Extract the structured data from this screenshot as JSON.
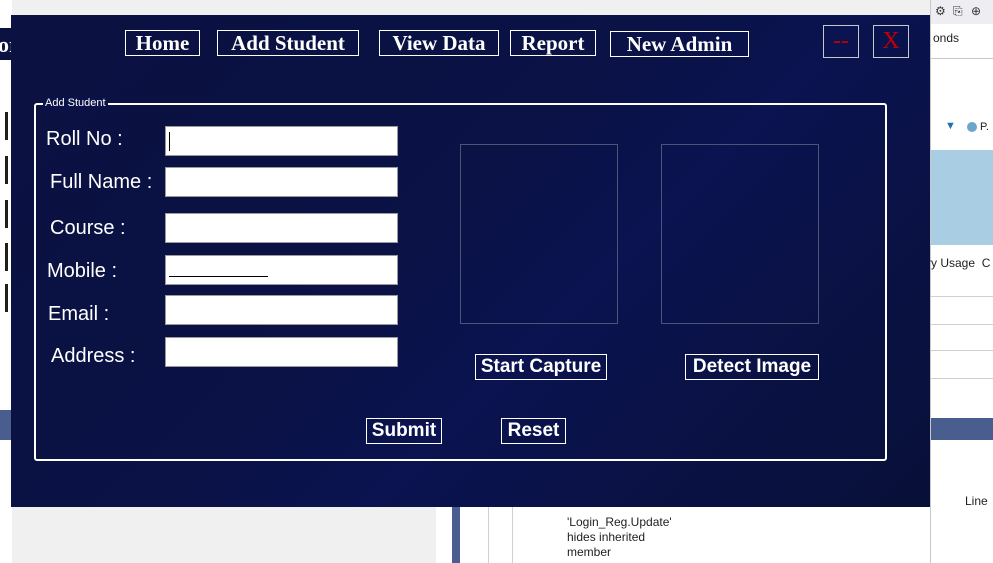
{
  "background": {
    "left_fragment_text": "or",
    "right_panel": {
      "seconds_text": "onds",
      "legend_marker": "▼",
      "legend_text": "P.",
      "usage_text": "ry Usage",
      "usage_suffix": "C",
      "line_header": "Line"
    },
    "error_list_message": "'Login_Reg.Update' hides inherited member"
  },
  "nav": {
    "home": "Home",
    "add_student": "Add Student",
    "view_data": "View Data",
    "report": "Report",
    "new_admin": "New Admin"
  },
  "window_buttons": {
    "minimize": "--",
    "close": "X"
  },
  "form": {
    "group_title": "Add Student",
    "labels": {
      "roll_no": "Roll No :",
      "full_name": "Full Name :",
      "course": "Course :",
      "mobile": "Mobile :",
      "email": "Email :",
      "address": "Address :"
    },
    "values": {
      "roll_no": "",
      "full_name": "",
      "course": "",
      "mobile": "",
      "email": "",
      "address": ""
    },
    "start_capture": "Start Capture",
    "detect_image": "Detect Image",
    "submit": "Submit",
    "reset": "Reset"
  },
  "colors": {
    "form_background": "#0b1140",
    "window_button_text": "#c00000",
    "button_border": "#ffffff"
  }
}
